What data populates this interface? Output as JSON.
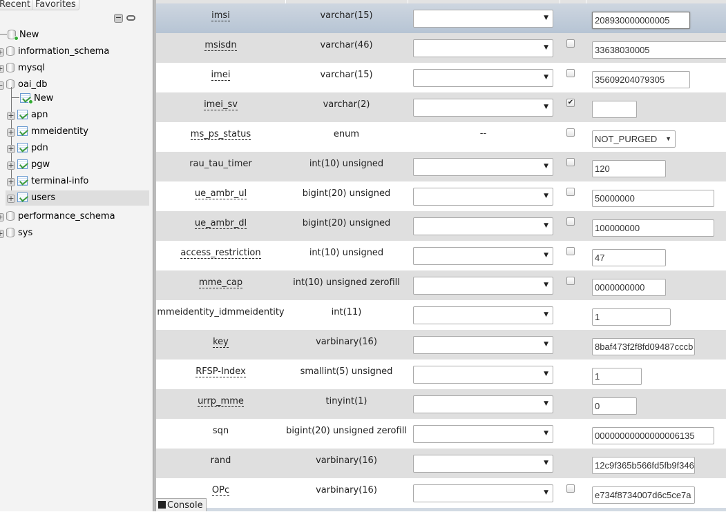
{
  "nav": {
    "tabs": [
      "Recent",
      "Favorites"
    ],
    "tree": [
      {
        "label": "New",
        "type": "new-db"
      },
      {
        "label": "information_schema",
        "type": "db"
      },
      {
        "label": "mysql",
        "type": "db"
      },
      {
        "label": "oai_db",
        "type": "db",
        "expanded": true,
        "children": [
          {
            "label": "New",
            "type": "new-table"
          },
          {
            "label": "apn",
            "type": "table"
          },
          {
            "label": "mmeidentity",
            "type": "table"
          },
          {
            "label": "pdn",
            "type": "table"
          },
          {
            "label": "pgw",
            "type": "table"
          },
          {
            "label": "terminal-info",
            "type": "table"
          },
          {
            "label": "users",
            "type": "table",
            "selected": true
          }
        ]
      },
      {
        "label": "performance_schema",
        "type": "db"
      },
      {
        "label": "sys",
        "type": "db"
      }
    ]
  },
  "rows": [
    {
      "name": "imsi",
      "type": "varchar(15)",
      "underline": true,
      "nullable": false,
      "value": "208930000000005",
      "row_style": "highlight"
    },
    {
      "name": "msisdn",
      "type": "varchar(46)",
      "underline": true,
      "nullable": true,
      "null_checked": false,
      "value": "33638030005"
    },
    {
      "name": "imei",
      "type": "varchar(15)",
      "underline": true,
      "nullable": true,
      "null_checked": false,
      "value": "35609204079305"
    },
    {
      "name": "imei_sv",
      "type": "varchar(2)",
      "underline": true,
      "nullable": true,
      "null_checked": true,
      "value": ""
    },
    {
      "name": "ms_ps_status",
      "type": "enum",
      "underline": true,
      "nullable": true,
      "null_checked": false,
      "value": "NOT_PURGED",
      "function": "--",
      "is_enum": true
    },
    {
      "name": "rau_tau_timer",
      "type": "int(10) unsigned",
      "underline": false,
      "nullable": true,
      "null_checked": false,
      "value": "120"
    },
    {
      "name": "ue_ambr_ul",
      "type": "bigint(20) unsigned",
      "underline": true,
      "nullable": true,
      "null_checked": false,
      "value": "50000000"
    },
    {
      "name": "ue_ambr_dl",
      "type": "bigint(20) unsigned",
      "underline": true,
      "nullable": true,
      "null_checked": false,
      "value": "100000000"
    },
    {
      "name": "access_restriction",
      "type": "int(10) unsigned",
      "underline": true,
      "nullable": true,
      "null_checked": false,
      "value": "47"
    },
    {
      "name": "mme_cap",
      "type": "int(10) unsigned zerofill",
      "underline": true,
      "nullable": true,
      "null_checked": false,
      "value": "0000000000"
    },
    {
      "name": "mmeidentity_idmmeidentity",
      "type": "int(11)",
      "underline": false,
      "nullable": false,
      "value": "1"
    },
    {
      "name": "key",
      "type": "varbinary(16)",
      "underline": true,
      "nullable": false,
      "value": "8baf473f2f8fd09487cccb"
    },
    {
      "name": "RFSP-Index",
      "type": "smallint(5) unsigned",
      "underline": true,
      "nullable": false,
      "value": "1"
    },
    {
      "name": "urrp_mme",
      "type": "tinyint(1)",
      "underline": true,
      "nullable": false,
      "value": "0"
    },
    {
      "name": "sqn",
      "type": "bigint(20) unsigned zerofill",
      "underline": false,
      "nullable": false,
      "value": "00000000000000006135"
    },
    {
      "name": "rand",
      "type": "varbinary(16)",
      "underline": false,
      "nullable": false,
      "value": "12c9f365b566fd5fb9f346"
    },
    {
      "name": "OPc",
      "type": "varbinary(16)",
      "underline": true,
      "nullable": true,
      "null_checked": false,
      "value": "e734f8734007d6c5ce7a"
    }
  ],
  "console": {
    "label": "Console"
  }
}
